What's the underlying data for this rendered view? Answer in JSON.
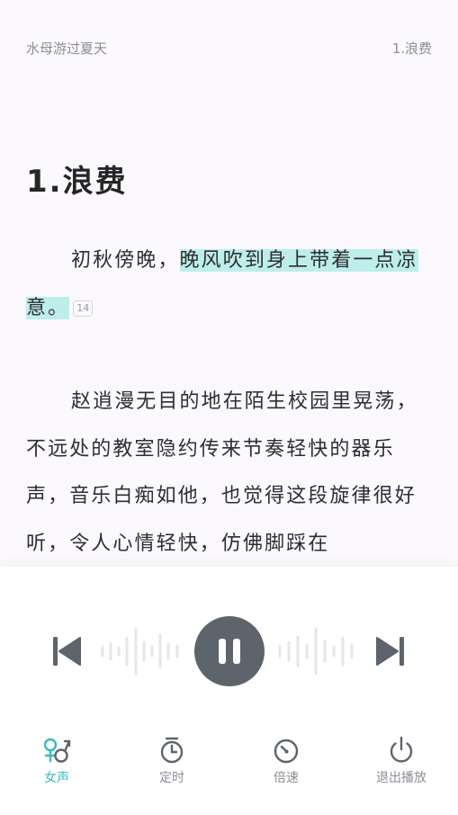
{
  "header": {
    "book_title": "水母游过夏天",
    "chapter_label": "1.浪费"
  },
  "chapter": {
    "title": "1.浪费"
  },
  "content": {
    "para1_plain": "初秋傍晚，",
    "para1_highlight_a": "晚风吹到身上带着一点",
    "para1_highlight_b": "凉意。",
    "para1_comment_count": "14",
    "para2": "赵逍漫无目的地在陌生校园里晃荡，不远处的教室隐约传来节奏轻快的器乐声，音乐白痴如他，也觉得这段旋律很好听，令人心情轻快，仿佛脚踩在"
  },
  "player": {
    "state": "playing",
    "prev_icon": "skip-previous-icon",
    "play_pause_icon": "pause-icon",
    "next_icon": "skip-next-icon"
  },
  "bottom_nav": {
    "items": [
      {
        "label": "女声",
        "icon": "female-male-voice-icon",
        "active": true
      },
      {
        "label": "定时",
        "icon": "timer-icon",
        "active": false
      },
      {
        "label": "倍速",
        "icon": "speed-dial-icon",
        "active": false
      },
      {
        "label": "退出播放",
        "icon": "power-icon",
        "active": false
      }
    ]
  },
  "colors": {
    "background": "#fbf9fd",
    "highlight": "#bdeeeb",
    "accent": "#36bcc1",
    "control": "#5e646b",
    "text": "#2e2e2e",
    "muted": "#8d8d93"
  }
}
